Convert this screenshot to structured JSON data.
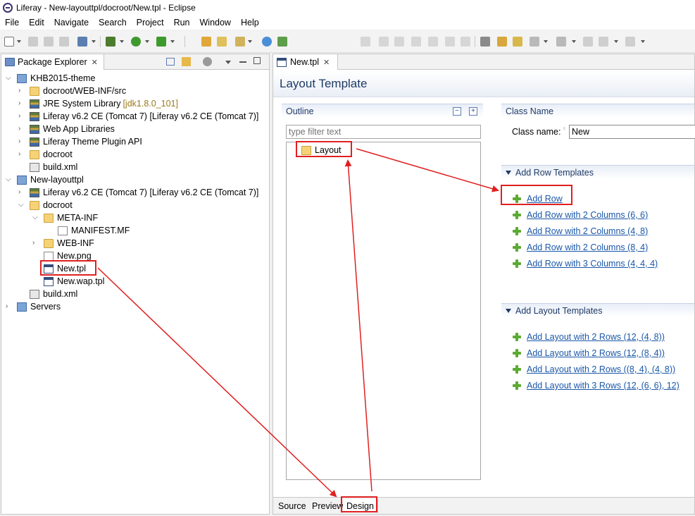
{
  "window": {
    "title": "Liferay - New-layouttpl/docroot/New.tpl - Eclipse"
  },
  "menu": [
    "File",
    "Edit",
    "Navigate",
    "Search",
    "Project",
    "Run",
    "Window",
    "Help"
  ],
  "package_explorer": {
    "tab_label": "Package Explorer",
    "close_glyph": "✕",
    "items": [
      {
        "label": "KHB2015-theme",
        "icon": "project-icon"
      },
      {
        "label": "docroot/WEB-INF/src",
        "icon": "source-folder-icon"
      },
      {
        "label": "JRE System Library",
        "deco": "[jdk1.8.0_101]",
        "icon": "library-icon"
      },
      {
        "label": "Liferay v6.2 CE (Tomcat 7) [Liferay v6.2 CE (Tomcat 7)]",
        "icon": "library-icon"
      },
      {
        "label": "Web App Libraries",
        "icon": "library-icon"
      },
      {
        "label": "Liferay Theme Plugin API",
        "icon": "library-icon"
      },
      {
        "label": "docroot",
        "icon": "folder-icon"
      },
      {
        "label": "build.xml",
        "icon": "xml-file-icon"
      },
      {
        "label": "New-layouttpl",
        "icon": "project-icon"
      },
      {
        "label": "Liferay v6.2 CE (Tomcat 7) [Liferay v6.2 CE (Tomcat 7)]",
        "icon": "library-icon"
      },
      {
        "label": "docroot",
        "icon": "folder-icon"
      },
      {
        "label": "META-INF",
        "icon": "folder-icon"
      },
      {
        "label": "MANIFEST.MF",
        "icon": "file-icon"
      },
      {
        "label": "WEB-INF",
        "icon": "folder-icon"
      },
      {
        "label": "New.png",
        "icon": "image-file-icon"
      },
      {
        "label": "New.tpl",
        "icon": "tpl-file-icon"
      },
      {
        "label": "New.wap.tpl",
        "icon": "tpl-file-icon"
      },
      {
        "label": "build.xml",
        "icon": "xml-file-icon"
      },
      {
        "label": "Servers",
        "icon": "servers-folder-icon"
      }
    ]
  },
  "editor": {
    "tab_label": "New.tpl",
    "close_glyph": "✕",
    "form_title": "Layout Template",
    "outline": {
      "title": "Outline",
      "collapse_glyph": "−",
      "expand_glyph": "+",
      "filter_placeholder": "type filter text",
      "node_label": "Layout"
    },
    "class_name": {
      "section_title": "Class Name",
      "label": "Class name:",
      "value": "New"
    },
    "row_templates": {
      "title": "Add Row Templates",
      "links": [
        "Add Row",
        "Add Row with 2 Columns (6, 6)",
        "Add Row with 2 Columns (4, 8)",
        "Add Row with 2 Columns (8, 4)",
        "Add Row with 3 Columns (4, 4, 4)"
      ]
    },
    "layout_templates": {
      "title": "Add Layout Templates",
      "links": [
        "Add Layout with 2 Rows (12, (4, 8))",
        "Add Layout with 2 Rows (12, (8, 4))",
        "Add Layout with 2 Rows ((8, 4), (4, 8))",
        "Add Layout with 3 Rows (12, (6, 6), 12)"
      ]
    },
    "bottom_tabs": [
      "Source",
      "Preview",
      "Design"
    ]
  },
  "colors": {
    "annotation": "#e02020",
    "link": "#1a57a8",
    "section_title": "#1f3a66"
  }
}
